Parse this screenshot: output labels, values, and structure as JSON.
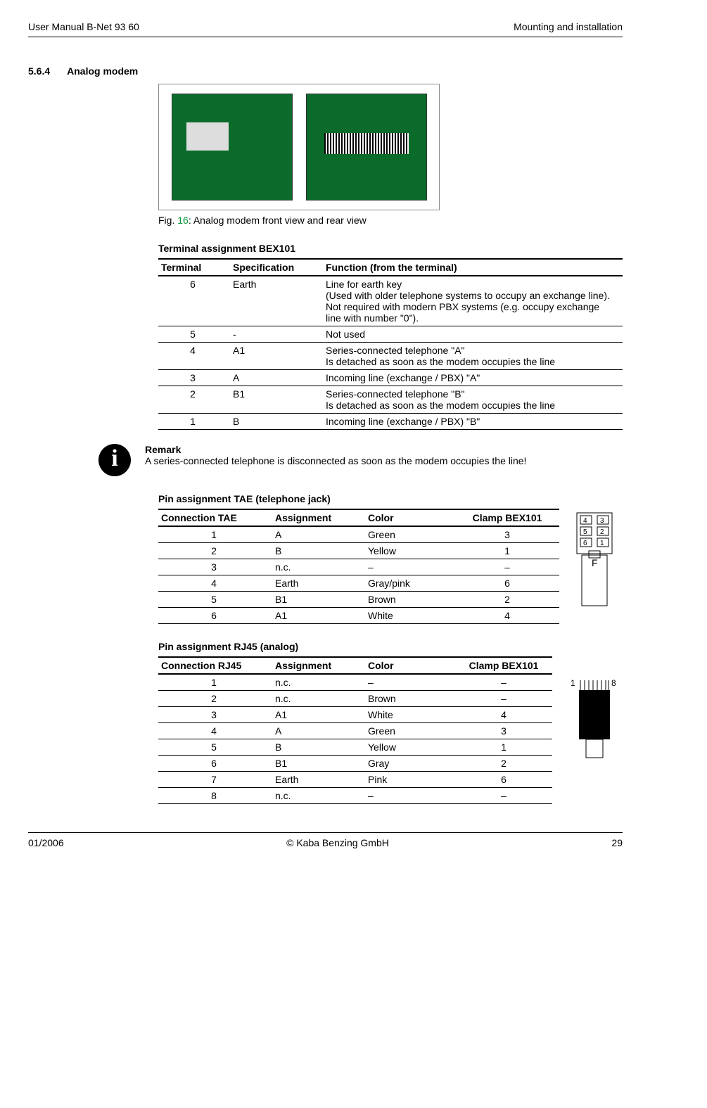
{
  "header": {
    "left": "User Manual B-Net 93 60",
    "right": "Mounting and installation"
  },
  "section": {
    "number": "5.6.4",
    "title": "Analog modem"
  },
  "figure": {
    "prefix": "Fig. ",
    "num": "16",
    "suffix": ": Analog modem front view and rear view"
  },
  "bex_title": "Terminal assignment BEX101",
  "bex_head": {
    "c0": "Terminal",
    "c1": "Specification",
    "c2": "Function (from the terminal)"
  },
  "bex_rows": [
    {
      "t": "6",
      "s": "Earth",
      "f": "Line for earth key\n(Used with older telephone systems to occupy an exchange line). Not required with modern PBX systems (e.g. occupy exchange line with number \"0\")."
    },
    {
      "t": "5",
      "s": "-",
      "f": "Not used"
    },
    {
      "t": "4",
      "s": "A1",
      "f": "Series-connected telephone \"A\"\nIs detached as soon as the modem occupies the line"
    },
    {
      "t": "3",
      "s": "A",
      "f": "Incoming line (exchange / PBX) \"A\""
    },
    {
      "t": "2",
      "s": "B1",
      "f": "Series-connected telephone \"B\"\nIs detached as soon as the modem occupies the line"
    },
    {
      "t": "1",
      "s": "B",
      "f": "Incoming line (exchange / PBX) \"B\""
    }
  ],
  "remark": {
    "title": "Remark",
    "body": "A series-connected telephone is disconnected as soon as the modem occupies the line!"
  },
  "tae_title": "Pin assignment TAE (telephone jack)",
  "tae_head": {
    "c0": "Connection TAE",
    "c1": "Assignment",
    "c2": "Color",
    "c3": "Clamp BEX101"
  },
  "tae_rows": [
    {
      "a": "1",
      "b": "A",
      "c": "Green",
      "d": "3"
    },
    {
      "a": "2",
      "b": "B",
      "c": "Yellow",
      "d": "1"
    },
    {
      "a": "3",
      "b": "n.c.",
      "c": "–",
      "d": "–"
    },
    {
      "a": "4",
      "b": "Earth",
      "c": "Gray/pink",
      "d": "6"
    },
    {
      "a": "5",
      "b": "B1",
      "c": "Brown",
      "d": "2"
    },
    {
      "a": "6",
      "b": "A1",
      "c": "White",
      "d": "4"
    }
  ],
  "tae_svg": {
    "p4": "4",
    "p3": "3",
    "p5": "5",
    "p2": "2",
    "p6": "6",
    "p1": "1",
    "f": "F"
  },
  "rj_title": "Pin assignment RJ45 (analog)",
  "rj_head": {
    "c0": "Connection RJ45",
    "c1": "Assignment",
    "c2": "Color",
    "c3": "Clamp BEX101"
  },
  "rj_rows": [
    {
      "a": "1",
      "b": "n.c.",
      "c": "–",
      "d": "–"
    },
    {
      "a": "2",
      "b": "n.c.",
      "c": "Brown",
      "d": "–"
    },
    {
      "a": "3",
      "b": "A1",
      "c": "White",
      "d": "4"
    },
    {
      "a": "4",
      "b": "A",
      "c": "Green",
      "d": "3"
    },
    {
      "a": "5",
      "b": "B",
      "c": "Yellow",
      "d": "1"
    },
    {
      "a": "6",
      "b": "B1",
      "c": "Gray",
      "d": "2"
    },
    {
      "a": "7",
      "b": "Earth",
      "c": "Pink",
      "d": "6"
    },
    {
      "a": "8",
      "b": "n.c.",
      "c": "–",
      "d": "–"
    }
  ],
  "rj_svg": {
    "l": "1",
    "r": "8"
  },
  "footer": {
    "left": "01/2006",
    "center": "© Kaba Benzing GmbH",
    "right": "29"
  }
}
